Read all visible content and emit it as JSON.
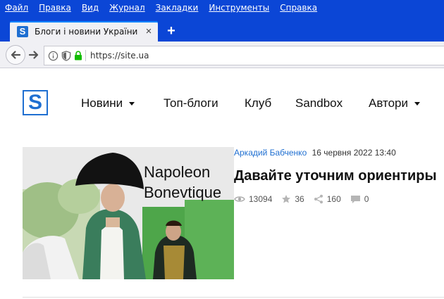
{
  "menubar": {
    "items": [
      "Файл",
      "Правка",
      "Вид",
      "Журнал",
      "Закладки",
      "Инструменты",
      "Справка"
    ]
  },
  "tab": {
    "favicon": "S",
    "title": "Блоги і новини України - site...",
    "close": "×"
  },
  "new_tab": "+",
  "address": {
    "url": "https://site.ua"
  },
  "site": {
    "logo": "S",
    "nav": [
      {
        "label": "Новини",
        "dropdown": true
      },
      {
        "label": "Топ-блоги",
        "dropdown": false
      },
      {
        "label": "Клуб",
        "dropdown": false
      },
      {
        "label": "Sandbox",
        "dropdown": false
      },
      {
        "label": "Автори",
        "dropdown": true
      }
    ]
  },
  "article": {
    "image_caption_line1": "Napoleon",
    "image_caption_line2": "Bonevtique",
    "author": "Аркадий Бабченко",
    "date": "16 червня 2022 13:40",
    "title": "Давайте уточним ориентиры",
    "views": "13094",
    "favorites": "36",
    "shares": "160",
    "comments": "0"
  },
  "colors": {
    "menubar_bg": "#0b46d6",
    "brand_blue": "#1f6fd1",
    "toolbar_bg": "#f0f0f4"
  }
}
